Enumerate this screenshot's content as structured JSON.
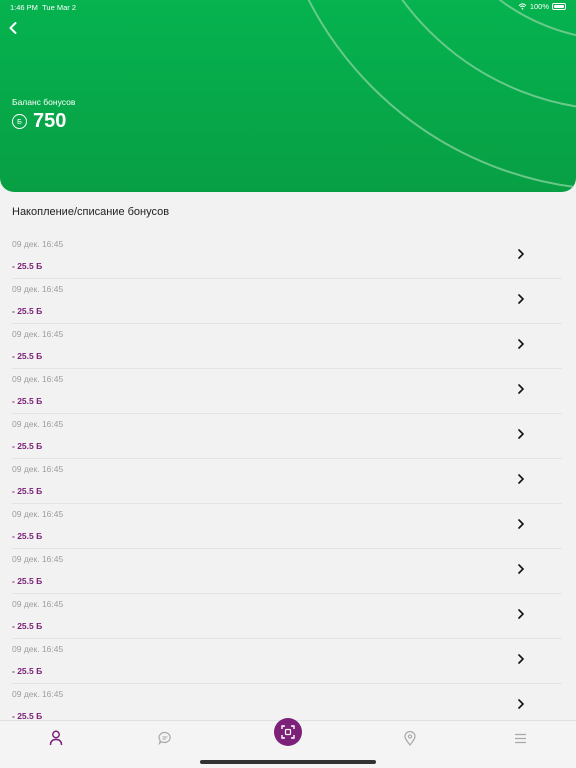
{
  "status": {
    "time": "1:46 PM",
    "date": "Tue Mar 2",
    "battery": "100%"
  },
  "header": {
    "balance_label": "Баланс бонусов",
    "coin_symbol": "Б",
    "balance_value": "750"
  },
  "section_title": "Накопление/списание бонусов",
  "transactions": [
    {
      "date": "09 дек. 16:45",
      "amount": "- 25.5 Б"
    },
    {
      "date": "09 дек. 16:45",
      "amount": "- 25.5 Б"
    },
    {
      "date": "09 дек. 16:45",
      "amount": "- 25.5 Б"
    },
    {
      "date": "09 дек. 16:45",
      "amount": "- 25.5 Б"
    },
    {
      "date": "09 дек. 16:45",
      "amount": "- 25.5 Б"
    },
    {
      "date": "09 дек. 16:45",
      "amount": "- 25.5 Б"
    },
    {
      "date": "09 дек. 16:45",
      "amount": "- 25.5 Б"
    },
    {
      "date": "09 дек. 16:45",
      "amount": "- 25.5 Б"
    },
    {
      "date": "09 дек. 16:45",
      "amount": "- 25.5 Б"
    },
    {
      "date": "09 дек. 16:45",
      "amount": "- 25.5 Б"
    },
    {
      "date": "09 дек. 16:45",
      "amount": "- 25.5 Б"
    }
  ],
  "tabs": [
    {
      "icon": "profile-icon",
      "active": true
    },
    {
      "icon": "chat-icon",
      "active": false
    },
    {
      "icon": "scan-icon",
      "active": false
    },
    {
      "icon": "location-icon",
      "active": false
    },
    {
      "icon": "menu-icon",
      "active": false
    }
  ],
  "colors": {
    "header_green": "#05b34f",
    "accent_purple": "#7b2178",
    "date_gray": "#9c9c9c"
  }
}
